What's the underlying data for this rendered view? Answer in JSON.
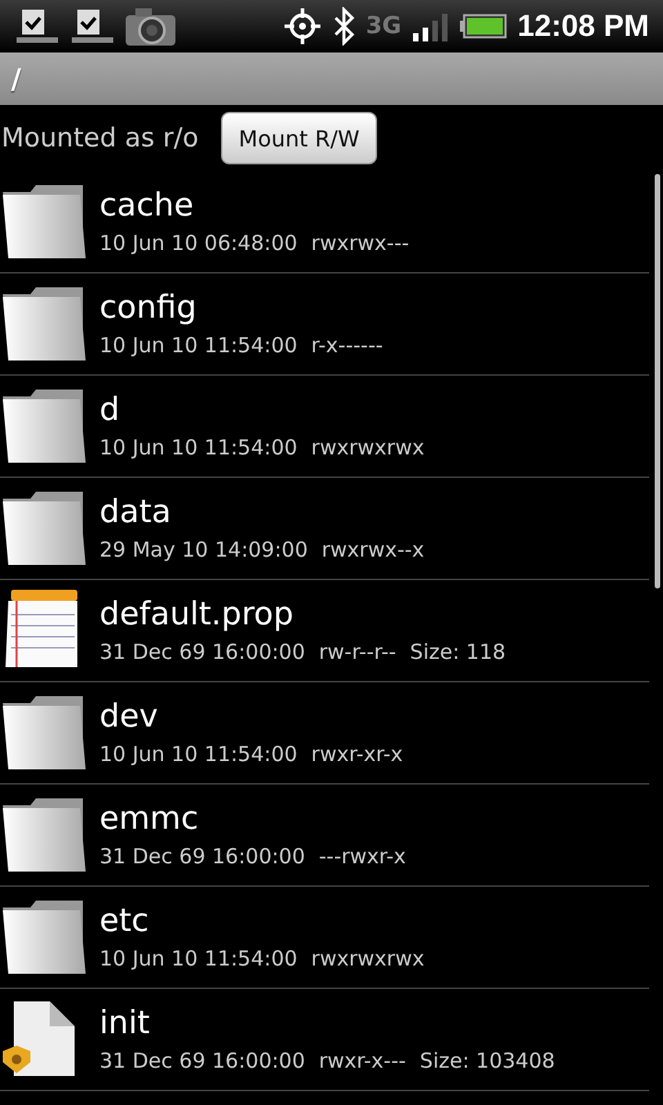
{
  "status_bar": {
    "network": "3G",
    "time": "12:08 PM"
  },
  "path_bar": {
    "path": "/"
  },
  "mount": {
    "label": "Mounted as r/o",
    "button": "Mount R/W"
  },
  "files": [
    {
      "kind": "folder",
      "name": "cache",
      "date": "10 Jun 10 06:48:00",
      "permissions": "rwxrwx---"
    },
    {
      "kind": "folder",
      "name": "config",
      "date": "10 Jun 10 11:54:00",
      "permissions": "r-x------"
    },
    {
      "kind": "folder",
      "name": "d",
      "date": "10 Jun 10 11:54:00",
      "permissions": "rwxrwxrwx"
    },
    {
      "kind": "folder",
      "name": "data",
      "date": "29 May 10 14:09:00",
      "permissions": "rwxrwx--x"
    },
    {
      "kind": "text",
      "name": "default.prop",
      "date": "31 Dec 69 16:00:00",
      "permissions": "rw-r--r--",
      "size": "Size: 118"
    },
    {
      "kind": "folder",
      "name": "dev",
      "date": "10 Jun 10 11:54:00",
      "permissions": "rwxr-xr-x"
    },
    {
      "kind": "folder",
      "name": "emmc",
      "date": "31 Dec 69 16:00:00",
      "permissions": "---rwxr-x"
    },
    {
      "kind": "folder",
      "name": "etc",
      "date": "10 Jun 10 11:54:00",
      "permissions": "rwxrwxrwx"
    },
    {
      "kind": "executable",
      "name": "init",
      "date": "31 Dec 69 16:00:00",
      "permissions": "rwxr-x---",
      "size": "Size: 103408"
    }
  ]
}
